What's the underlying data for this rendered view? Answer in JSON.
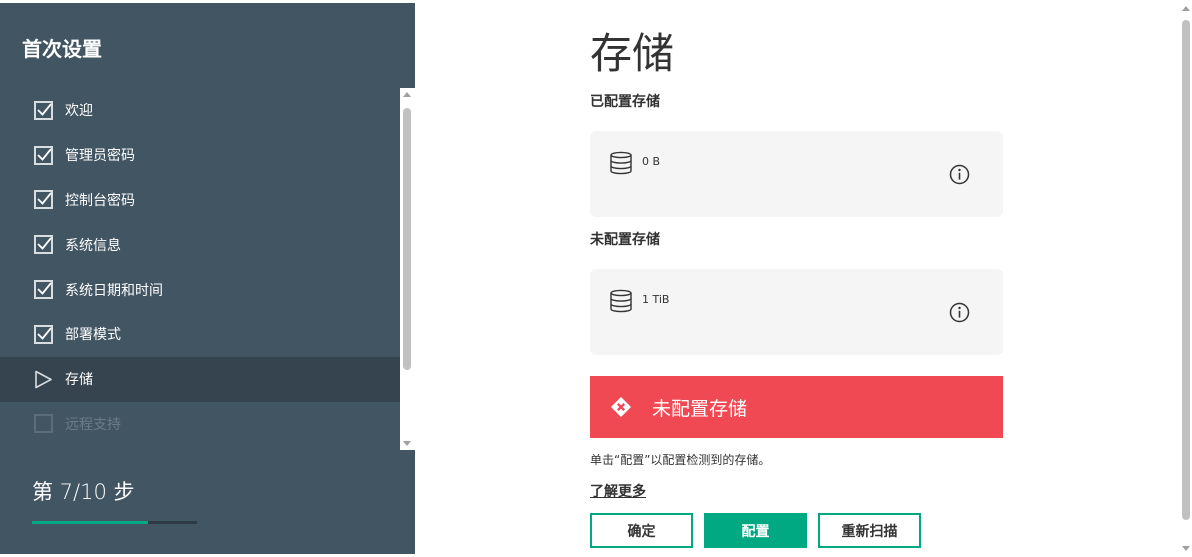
{
  "sidebar": {
    "title": "首次设置",
    "steps": [
      {
        "label": "欢迎",
        "state": "done"
      },
      {
        "label": "管理员密码",
        "state": "done"
      },
      {
        "label": "控制台密码",
        "state": "done"
      },
      {
        "label": "系统信息",
        "state": "done"
      },
      {
        "label": "系统日期和时间",
        "state": "done"
      },
      {
        "label": "部署模式",
        "state": "done"
      },
      {
        "label": "存储",
        "state": "active"
      },
      {
        "label": "远程支持",
        "state": "disabled"
      }
    ],
    "step_count": "第 7/10 步",
    "progress_fraction": 0.7
  },
  "main": {
    "title": "存储",
    "configured": {
      "label": "已配置存储",
      "value": "0 B"
    },
    "unconfigured": {
      "label": "未配置存储",
      "value": "1 TiB"
    },
    "alert": {
      "text": "未配置存储",
      "color": "#f04953"
    },
    "hint": "单击“配置”以配置检测到的存储。",
    "learn_more": "了解更多",
    "buttons": {
      "ok": "确定",
      "configure": "配置",
      "rescan": "重新扫描"
    }
  },
  "colors": {
    "sidebar_bg": "#425563",
    "accent": "#01a982",
    "alert": "#f04953"
  },
  "icons": {
    "step_done": "checkbox-checked-icon",
    "step_active": "triangle-play-icon",
    "storage": "database-icon",
    "info": "info-circle-icon",
    "alert": "critical-diamond-icon"
  }
}
